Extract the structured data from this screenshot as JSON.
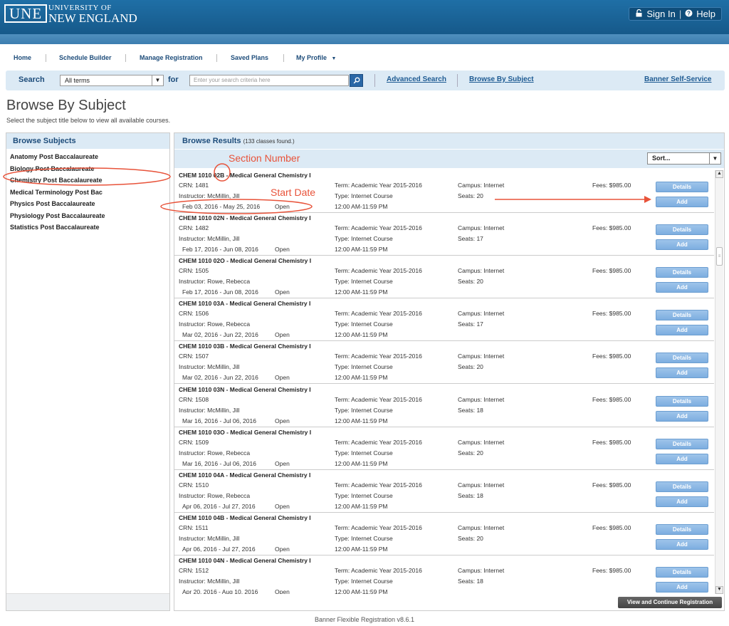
{
  "header": {
    "logo_mark": "UNE",
    "logo_line1": "UNIVERSITY OF",
    "logo_line2": "NEW ENGLAND",
    "sign_in": "Sign In",
    "divider": "|",
    "help": "Help"
  },
  "nav": {
    "items": [
      "Home",
      "Schedule Builder",
      "Manage Registration",
      "Saved Plans",
      "My Profile"
    ]
  },
  "search": {
    "label": "Search",
    "term_value": "All terms",
    "for_label": "for",
    "placeholder": "Enter your search criteria here",
    "advanced": "Advanced Search",
    "browse": "Browse By Subject",
    "banner": "Banner Self-Service"
  },
  "page": {
    "title": "Browse By Subject",
    "subtitle": "Select the subject title below to view all available courses."
  },
  "subjects": {
    "heading": "Browse Subjects",
    "items": [
      "Anatomy Post Baccalaureate",
      "Biology Post Baccalaureate",
      "Chemistry Post Baccalaureate",
      "Medical Terminology Post Bac",
      "Physics Post Baccalaureate",
      "Physiology Post Baccalaureate",
      "Statistics Post Baccalaureate"
    ]
  },
  "results": {
    "heading": "Browse Results",
    "count": "(133 classes found.)",
    "sort": "Sort...",
    "details_label": "Details",
    "add_label": "Add",
    "courses": [
      {
        "title": "CHEM 1010 02B - Medical General Chemistry I",
        "crn": "CRN: 1481",
        "instructor": "Instructor: McMillin, Jill",
        "dates": "Feb 03, 2016 - May 25, 2016",
        "status": "Open",
        "term": "Term: Academic Year 2015-2016",
        "type": "Type: Internet Course",
        "time": "12:00 AM-11:59 PM",
        "campus": "Campus: Internet",
        "seats": "Seats: 20",
        "fees": "Fees: $985.00"
      },
      {
        "title": "CHEM 1010 02N - Medical General Chemistry I",
        "crn": "CRN: 1482",
        "instructor": "Instructor: McMillin, Jill",
        "dates": "Feb 17, 2016 - Jun 08, 2016",
        "status": "Open",
        "term": "Term: Academic Year 2015-2016",
        "type": "Type: Internet Course",
        "time": "12:00 AM-11:59 PM",
        "campus": "Campus: Internet",
        "seats": "Seats: 17",
        "fees": "Fees: $985.00"
      },
      {
        "title": "CHEM 1010 02O - Medical General Chemistry I",
        "crn": "CRN: 1505",
        "instructor": "Instructor: Rowe, Rebecca",
        "dates": "Feb 17, 2016 - Jun 08, 2016",
        "status": "Open",
        "term": "Term: Academic Year 2015-2016",
        "type": "Type: Internet Course",
        "time": "12:00 AM-11:59 PM",
        "campus": "Campus: Internet",
        "seats": "Seats: 20",
        "fees": "Fees: $985.00"
      },
      {
        "title": "CHEM 1010 03A - Medical General Chemistry I",
        "crn": "CRN: 1506",
        "instructor": "Instructor: Rowe, Rebecca",
        "dates": "Mar 02, 2016 - Jun 22, 2016",
        "status": "Open",
        "term": "Term: Academic Year 2015-2016",
        "type": "Type: Internet Course",
        "time": "12:00 AM-11:59 PM",
        "campus": "Campus: Internet",
        "seats": "Seats: 17",
        "fees": "Fees: $985.00"
      },
      {
        "title": "CHEM 1010 03B - Medical General Chemistry I",
        "crn": "CRN: 1507",
        "instructor": "Instructor: McMillin, Jill",
        "dates": "Mar 02, 2016 - Jun 22, 2016",
        "status": "Open",
        "term": "Term: Academic Year 2015-2016",
        "type": "Type: Internet Course",
        "time": "12:00 AM-11:59 PM",
        "campus": "Campus: Internet",
        "seats": "Seats: 20",
        "fees": "Fees: $985.00"
      },
      {
        "title": "CHEM 1010 03N - Medical General Chemistry I",
        "crn": "CRN: 1508",
        "instructor": "Instructor: McMillin, Jill",
        "dates": "Mar 16, 2016 - Jul 06, 2016",
        "status": "Open",
        "term": "Term: Academic Year 2015-2016",
        "type": "Type: Internet Course",
        "time": "12:00 AM-11:59 PM",
        "campus": "Campus: Internet",
        "seats": "Seats: 18",
        "fees": "Fees: $985.00"
      },
      {
        "title": "CHEM 1010 03O - Medical General Chemistry I",
        "crn": "CRN: 1509",
        "instructor": "Instructor: Rowe, Rebecca",
        "dates": "Mar 16, 2016 - Jul 06, 2016",
        "status": "Open",
        "term": "Term: Academic Year 2015-2016",
        "type": "Type: Internet Course",
        "time": "12:00 AM-11:59 PM",
        "campus": "Campus: Internet",
        "seats": "Seats: 20",
        "fees": "Fees: $985.00"
      },
      {
        "title": "CHEM 1010 04A - Medical General Chemistry I",
        "crn": "CRN: 1510",
        "instructor": "Instructor: Rowe, Rebecca",
        "dates": "Apr 06, 2016 - Jul 27, 2016",
        "status": "Open",
        "term": "Term: Academic Year 2015-2016",
        "type": "Type: Internet Course",
        "time": "12:00 AM-11:59 PM",
        "campus": "Campus: Internet",
        "seats": "Seats: 18",
        "fees": "Fees: $985.00"
      },
      {
        "title": "CHEM 1010 04B - Medical General Chemistry I",
        "crn": "CRN: 1511",
        "instructor": "Instructor: McMillin, Jill",
        "dates": "Apr 06, 2016 - Jul 27, 2016",
        "status": "Open",
        "term": "Term: Academic Year 2015-2016",
        "type": "Type: Internet Course",
        "time": "12:00 AM-11:59 PM",
        "campus": "Campus: Internet",
        "seats": "Seats: 20",
        "fees": "Fees: $985.00"
      },
      {
        "title": "CHEM 1010 04N - Medical General Chemistry I",
        "crn": "CRN: 1512",
        "instructor": "Instructor: McMillin, Jill",
        "dates": "Apr 20, 2016 - Aug 10, 2016",
        "status": "Open",
        "term": "Term: Academic Year 2015-2016",
        "type": "Type: Internet Course",
        "time": "12:00 AM-11:59 PM",
        "campus": "Campus: Internet",
        "seats": "Seats: 18",
        "fees": "Fees: $985.00"
      }
    ],
    "continue_label": "View and Continue Registration"
  },
  "annotations": {
    "section_number": "Section Number",
    "start_date": "Start Date",
    "color": "#e8533a"
  },
  "footer": "Banner Flexible Registration v8.6.1",
  "icons": {
    "lock": "lock-icon",
    "help": "help-icon",
    "search": "search-icon"
  }
}
